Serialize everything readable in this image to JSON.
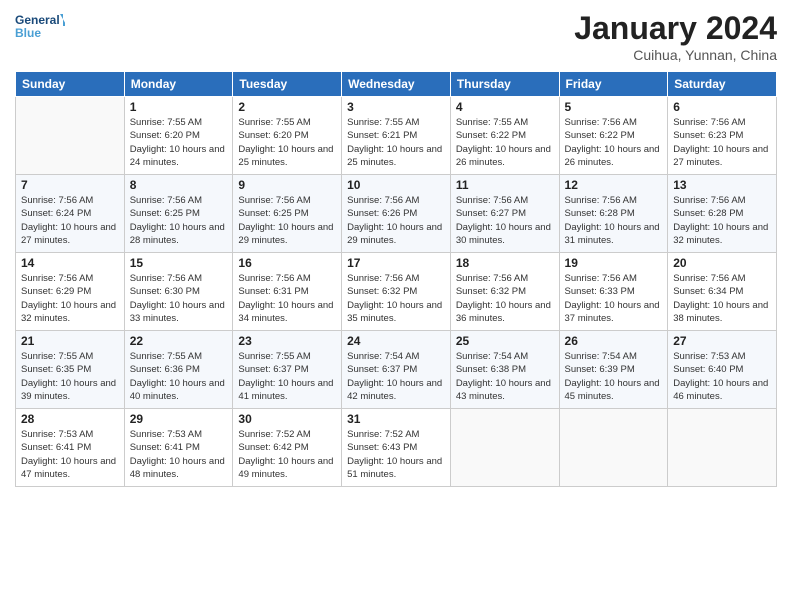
{
  "header": {
    "logo_line1": "General",
    "logo_line2": "Blue",
    "title": "January 2024",
    "subtitle": "Cuihua, Yunnan, China"
  },
  "days_of_week": [
    "Sunday",
    "Monday",
    "Tuesday",
    "Wednesday",
    "Thursday",
    "Friday",
    "Saturday"
  ],
  "weeks": [
    [
      {
        "day": "",
        "sunrise": "",
        "sunset": "",
        "daylight": ""
      },
      {
        "day": "1",
        "sunrise": "Sunrise: 7:55 AM",
        "sunset": "Sunset: 6:20 PM",
        "daylight": "Daylight: 10 hours and 24 minutes."
      },
      {
        "day": "2",
        "sunrise": "Sunrise: 7:55 AM",
        "sunset": "Sunset: 6:20 PM",
        "daylight": "Daylight: 10 hours and 25 minutes."
      },
      {
        "day": "3",
        "sunrise": "Sunrise: 7:55 AM",
        "sunset": "Sunset: 6:21 PM",
        "daylight": "Daylight: 10 hours and 25 minutes."
      },
      {
        "day": "4",
        "sunrise": "Sunrise: 7:55 AM",
        "sunset": "Sunset: 6:22 PM",
        "daylight": "Daylight: 10 hours and 26 minutes."
      },
      {
        "day": "5",
        "sunrise": "Sunrise: 7:56 AM",
        "sunset": "Sunset: 6:22 PM",
        "daylight": "Daylight: 10 hours and 26 minutes."
      },
      {
        "day": "6",
        "sunrise": "Sunrise: 7:56 AM",
        "sunset": "Sunset: 6:23 PM",
        "daylight": "Daylight: 10 hours and 27 minutes."
      }
    ],
    [
      {
        "day": "7",
        "sunrise": "Sunrise: 7:56 AM",
        "sunset": "Sunset: 6:24 PM",
        "daylight": "Daylight: 10 hours and 27 minutes."
      },
      {
        "day": "8",
        "sunrise": "Sunrise: 7:56 AM",
        "sunset": "Sunset: 6:25 PM",
        "daylight": "Daylight: 10 hours and 28 minutes."
      },
      {
        "day": "9",
        "sunrise": "Sunrise: 7:56 AM",
        "sunset": "Sunset: 6:25 PM",
        "daylight": "Daylight: 10 hours and 29 minutes."
      },
      {
        "day": "10",
        "sunrise": "Sunrise: 7:56 AM",
        "sunset": "Sunset: 6:26 PM",
        "daylight": "Daylight: 10 hours and 29 minutes."
      },
      {
        "day": "11",
        "sunrise": "Sunrise: 7:56 AM",
        "sunset": "Sunset: 6:27 PM",
        "daylight": "Daylight: 10 hours and 30 minutes."
      },
      {
        "day": "12",
        "sunrise": "Sunrise: 7:56 AM",
        "sunset": "Sunset: 6:28 PM",
        "daylight": "Daylight: 10 hours and 31 minutes."
      },
      {
        "day": "13",
        "sunrise": "Sunrise: 7:56 AM",
        "sunset": "Sunset: 6:28 PM",
        "daylight": "Daylight: 10 hours and 32 minutes."
      }
    ],
    [
      {
        "day": "14",
        "sunrise": "Sunrise: 7:56 AM",
        "sunset": "Sunset: 6:29 PM",
        "daylight": "Daylight: 10 hours and 32 minutes."
      },
      {
        "day": "15",
        "sunrise": "Sunrise: 7:56 AM",
        "sunset": "Sunset: 6:30 PM",
        "daylight": "Daylight: 10 hours and 33 minutes."
      },
      {
        "day": "16",
        "sunrise": "Sunrise: 7:56 AM",
        "sunset": "Sunset: 6:31 PM",
        "daylight": "Daylight: 10 hours and 34 minutes."
      },
      {
        "day": "17",
        "sunrise": "Sunrise: 7:56 AM",
        "sunset": "Sunset: 6:32 PM",
        "daylight": "Daylight: 10 hours and 35 minutes."
      },
      {
        "day": "18",
        "sunrise": "Sunrise: 7:56 AM",
        "sunset": "Sunset: 6:32 PM",
        "daylight": "Daylight: 10 hours and 36 minutes."
      },
      {
        "day": "19",
        "sunrise": "Sunrise: 7:56 AM",
        "sunset": "Sunset: 6:33 PM",
        "daylight": "Daylight: 10 hours and 37 minutes."
      },
      {
        "day": "20",
        "sunrise": "Sunrise: 7:56 AM",
        "sunset": "Sunset: 6:34 PM",
        "daylight": "Daylight: 10 hours and 38 minutes."
      }
    ],
    [
      {
        "day": "21",
        "sunrise": "Sunrise: 7:55 AM",
        "sunset": "Sunset: 6:35 PM",
        "daylight": "Daylight: 10 hours and 39 minutes."
      },
      {
        "day": "22",
        "sunrise": "Sunrise: 7:55 AM",
        "sunset": "Sunset: 6:36 PM",
        "daylight": "Daylight: 10 hours and 40 minutes."
      },
      {
        "day": "23",
        "sunrise": "Sunrise: 7:55 AM",
        "sunset": "Sunset: 6:37 PM",
        "daylight": "Daylight: 10 hours and 41 minutes."
      },
      {
        "day": "24",
        "sunrise": "Sunrise: 7:54 AM",
        "sunset": "Sunset: 6:37 PM",
        "daylight": "Daylight: 10 hours and 42 minutes."
      },
      {
        "day": "25",
        "sunrise": "Sunrise: 7:54 AM",
        "sunset": "Sunset: 6:38 PM",
        "daylight": "Daylight: 10 hours and 43 minutes."
      },
      {
        "day": "26",
        "sunrise": "Sunrise: 7:54 AM",
        "sunset": "Sunset: 6:39 PM",
        "daylight": "Daylight: 10 hours and 45 minutes."
      },
      {
        "day": "27",
        "sunrise": "Sunrise: 7:53 AM",
        "sunset": "Sunset: 6:40 PM",
        "daylight": "Daylight: 10 hours and 46 minutes."
      }
    ],
    [
      {
        "day": "28",
        "sunrise": "Sunrise: 7:53 AM",
        "sunset": "Sunset: 6:41 PM",
        "daylight": "Daylight: 10 hours and 47 minutes."
      },
      {
        "day": "29",
        "sunrise": "Sunrise: 7:53 AM",
        "sunset": "Sunset: 6:41 PM",
        "daylight": "Daylight: 10 hours and 48 minutes."
      },
      {
        "day": "30",
        "sunrise": "Sunrise: 7:52 AM",
        "sunset": "Sunset: 6:42 PM",
        "daylight": "Daylight: 10 hours and 49 minutes."
      },
      {
        "day": "31",
        "sunrise": "Sunrise: 7:52 AM",
        "sunset": "Sunset: 6:43 PM",
        "daylight": "Daylight: 10 hours and 51 minutes."
      },
      {
        "day": "",
        "sunrise": "",
        "sunset": "",
        "daylight": ""
      },
      {
        "day": "",
        "sunrise": "",
        "sunset": "",
        "daylight": ""
      },
      {
        "day": "",
        "sunrise": "",
        "sunset": "",
        "daylight": ""
      }
    ]
  ]
}
